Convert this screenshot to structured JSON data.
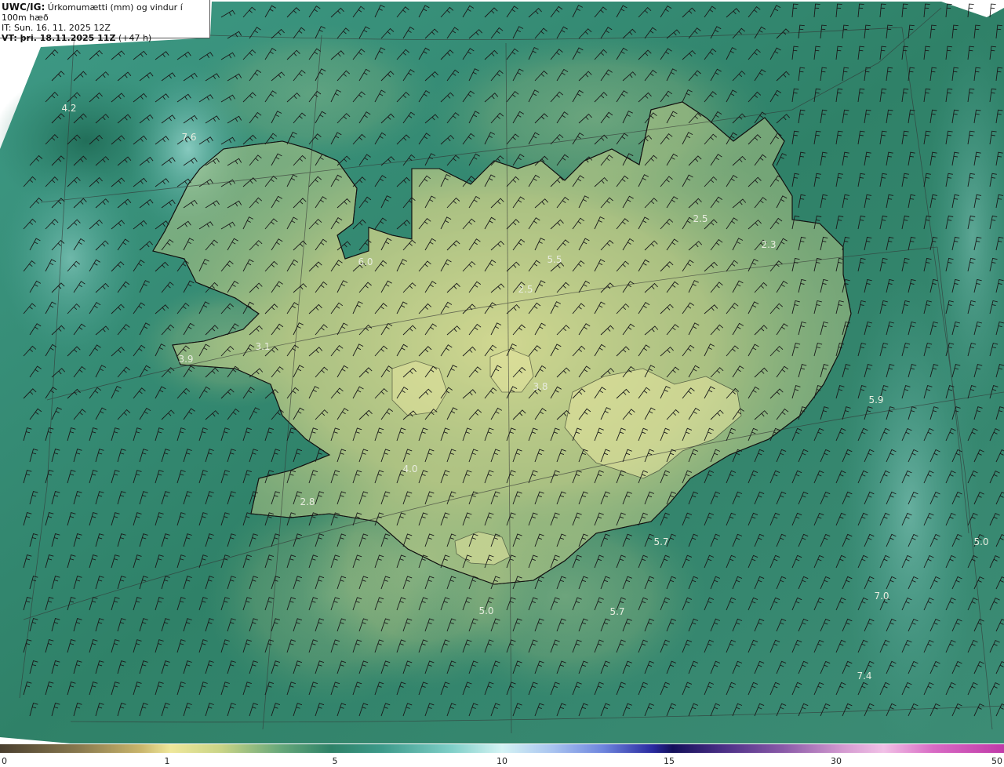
{
  "info": {
    "model": "UWC/IG:",
    "description": "Úrkomumætti (mm) og vindur í 100m hæð",
    "init_time": "IT: Sun. 16. 11. 2025 12Z",
    "valid_label": "VT: þri. 18.11.2025 11Z",
    "lead_time": "(+47 h)"
  },
  "map_labels": [
    "4.2",
    "7.6",
    "6.0",
    "5.5",
    "2.5",
    "2.5",
    "2.3",
    "3.1",
    "3.9",
    "3.8",
    "4.0",
    "2.8",
    "5.9",
    "5.7",
    "5.0",
    "5.7",
    "5.0",
    "7.0",
    "7.4"
  ],
  "colorbar": {
    "ticks": [
      "0",
      "1",
      "5",
      "10",
      "15",
      "30",
      "50"
    ]
  },
  "colors": {
    "sea_base": "#2c7f68",
    "land_high": "#d6d98c",
    "coastline": "#111111",
    "barb": "#1a1a1a",
    "label": "#e8ecdf"
  }
}
